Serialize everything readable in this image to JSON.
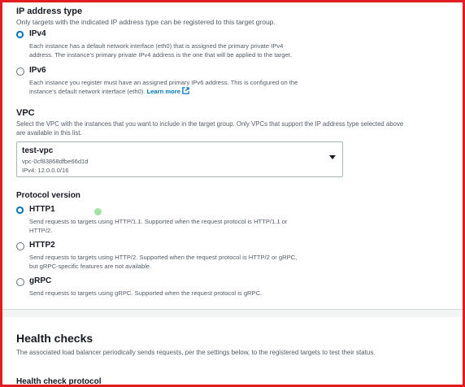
{
  "ip_address_type": {
    "title": "IP address type",
    "description": "Only targets with the indicated IP address type can be registered to this target group.",
    "options": [
      {
        "label": "IPv4",
        "selected": true,
        "desc_line1": "Each instance has a default network interface (eth0) that is assigned the primary private IPv4",
        "desc_line2": "address. The instance's primary private IPv4 address is the one that will be applied to the target."
      },
      {
        "label": "IPv6",
        "selected": false,
        "desc_line1": "Each instance you register must have an assigned primary IPv6 address. This is configured on the",
        "desc_line2": "instance's default network interface (eth0).",
        "link": "Learn more"
      }
    ]
  },
  "vpc": {
    "title": "VPC",
    "desc_line1": "Select the VPC with the instances that you want to include in the target group. Only VPCs that support the IP address type selected above",
    "desc_line2": "are available in this list.",
    "selected_name": "test-vpc",
    "selected_id": "vpc-0cf83868dfbe66d1d",
    "selected_cidr": "IPv4: 12.0.0.0/16"
  },
  "protocol_version": {
    "title": "Protocol version",
    "options": [
      {
        "label": "HTTP1",
        "selected": true,
        "desc_line1": "Send requests to targets using HTTP/1.1. Supported when the request protocol is HTTP/1.1 or",
        "desc_line2": "HTTP/2."
      },
      {
        "label": "HTTP2",
        "selected": false,
        "desc_line1": "Send requests to targets using HTTP/2. Supported when the request protocol is HTTP/2 or gRPC,",
        "desc_line2": "but gRPC-specific features are not available."
      },
      {
        "label": "gRPC",
        "selected": false,
        "desc_line1": "Send requests to targets using gRPC. Supported when the request protocol is gRPC."
      }
    ]
  },
  "health_checks": {
    "title": "Health checks",
    "description": "The associated load balancer periodically sends requests, per the settings below, to the registered targets to test their status.",
    "next_field_label": "Health check protocol"
  },
  "colors": {
    "accent": "#0073bb",
    "frame_border": "#e31b23",
    "text_primary": "#16191f",
    "text_secondary": "#545b64"
  },
  "icons": {
    "external_link": "external-link-icon",
    "dropdown": "caret-down-icon"
  }
}
